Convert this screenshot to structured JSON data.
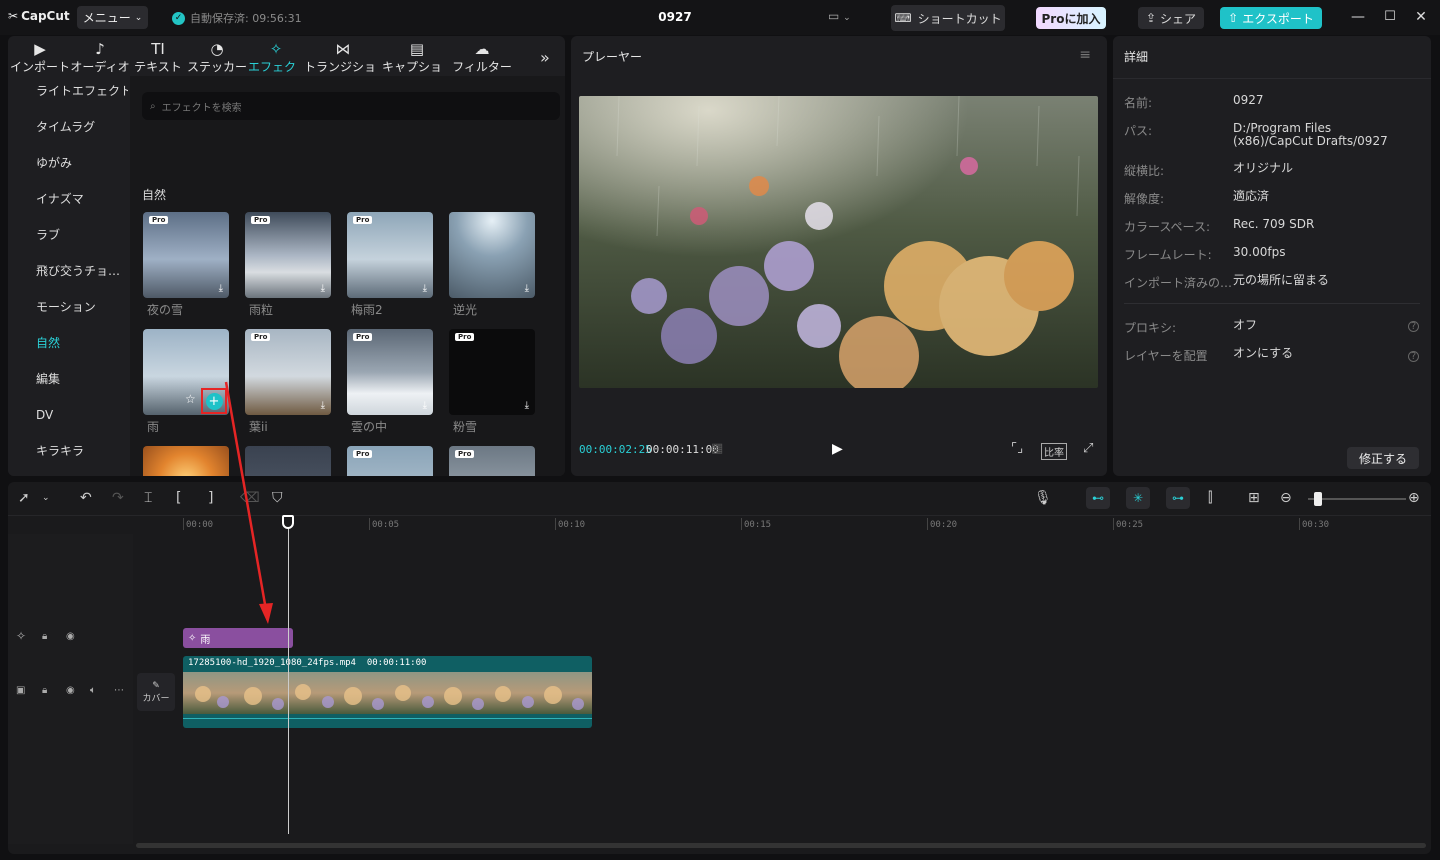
{
  "titlebar": {
    "logo": "CapCut",
    "menu_label": "メニュー",
    "autosave": "自動保存済: 09:56:31",
    "project_title": "0927",
    "shortcut_label": "ショートカット",
    "pro_label": "Proに加入",
    "share_label": "シェア",
    "export_label": "エクスポート"
  },
  "tabs": [
    {
      "label": "インポート",
      "icon": "import-icon"
    },
    {
      "label": "オーディオ",
      "icon": "audio-icon"
    },
    {
      "label": "テキスト",
      "icon": "text-icon"
    },
    {
      "label": "ステッカー",
      "icon": "sticker-icon"
    },
    {
      "label": "エフェクト",
      "icon": "effects-icon"
    },
    {
      "label": "トランジション",
      "icon": "transition-icon"
    },
    {
      "label": "キャプション",
      "icon": "caption-icon"
    },
    {
      "label": "フィルター",
      "icon": "filter-icon"
    }
  ],
  "categories": [
    "ライトエフェクト",
    "タイムラグ",
    "ゆがみ",
    "イナズマ",
    "ラブ",
    "飛び交うチョ…",
    "モーション",
    "自然",
    "編集",
    "DV",
    "キラキラ"
  ],
  "search_placeholder": "エフェクトを検索",
  "section_title": "自然",
  "effects": [
    {
      "name": "夜の雪",
      "pro": "Pro"
    },
    {
      "name": "雨粒",
      "pro": "Pro"
    },
    {
      "name": "梅雨2",
      "pro": "Pro"
    },
    {
      "name": "逆光",
      "pro": ""
    },
    {
      "name": "雨",
      "pro": ""
    },
    {
      "name": "葉ii",
      "pro": "Pro"
    },
    {
      "name": "雲の中",
      "pro": "Pro"
    },
    {
      "name": "粉雪",
      "pro": "Pro"
    },
    {
      "name": "",
      "pro": ""
    },
    {
      "name": "",
      "pro": ""
    },
    {
      "name": "",
      "pro": "Pro"
    },
    {
      "name": "",
      "pro": "Pro"
    }
  ],
  "player": {
    "title": "プレーヤー",
    "current_time": "00:00:02:25",
    "total_time": "00:00:11:00",
    "ratio_label": "比率"
  },
  "details": {
    "title": "詳細",
    "rows": [
      {
        "label": "名前:",
        "value": "0927"
      },
      {
        "label": "パス:",
        "value": "D:/Program Files (x86)/CapCut Drafts/0927"
      },
      {
        "label": "縦横比:",
        "value": "オリジナル"
      },
      {
        "label": "解像度:",
        "value": "適応済"
      },
      {
        "label": "カラースペース:",
        "value": "Rec. 709 SDR"
      },
      {
        "label": "フレームレート:",
        "value": "30.00fps"
      },
      {
        "label": "インポート済みの…",
        "value": "元の場所に留まる"
      }
    ],
    "rows2": [
      {
        "label": "プロキシ:",
        "value": "オフ"
      },
      {
        "label": "レイヤーを配置",
        "value": "オンにする"
      }
    ],
    "fix_button": "修正する"
  },
  "timeline": {
    "ticks": [
      "00:00",
      "00:05",
      "00:10",
      "00:15",
      "00:20",
      "00:25",
      "00:30"
    ],
    "effect_clip": "雨",
    "video_clip_name": "17285100-hd_1920_1080_24fps.mp4",
    "video_clip_duration": "00:00:11:00",
    "cover_label": "カバー"
  },
  "colors": {
    "accent": "#1fc2c8",
    "effect_clip": "#8a4f9f",
    "video_clip": "#0f5f63",
    "highlight_box": "#e52525"
  }
}
